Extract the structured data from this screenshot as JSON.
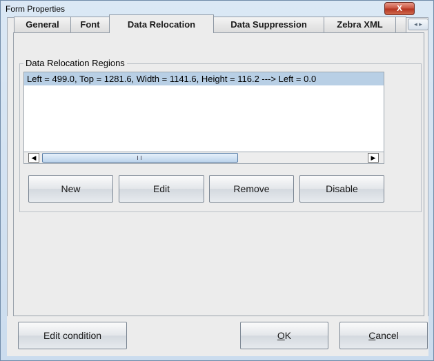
{
  "window": {
    "title": "Form Properties",
    "close_glyph": "X"
  },
  "tabs": [
    {
      "label": "General",
      "active": false
    },
    {
      "label": "Font",
      "active": false
    },
    {
      "label": "Data Relocation",
      "active": true
    },
    {
      "label": "Data Suppression",
      "active": false
    },
    {
      "label": "Zebra XML",
      "active": false
    }
  ],
  "tab_scroll": {
    "icon": "tab-scroll-arrows"
  },
  "group": {
    "title": "Data Relocation Regions",
    "items": [
      {
        "text": "Left = 499.0, Top = 1281.6, Width = 1141.6, Height = 116.2 ---> Left = 0.0",
        "selected": true
      }
    ]
  },
  "scrollbar": {
    "left_arrow": "◀",
    "right_arrow": "▶"
  },
  "buttons": {
    "new": "New",
    "edit": "Edit",
    "remove": "Remove",
    "disable": "Disable"
  },
  "footer": {
    "edit_condition": "Edit condition",
    "ok_mnemonic": "O",
    "ok_rest": "K",
    "cancel_mnemonic": "C",
    "cancel_rest": "ancel"
  },
  "colors": {
    "selection": "#b8cfe5",
    "close_button": "#c8503c"
  }
}
